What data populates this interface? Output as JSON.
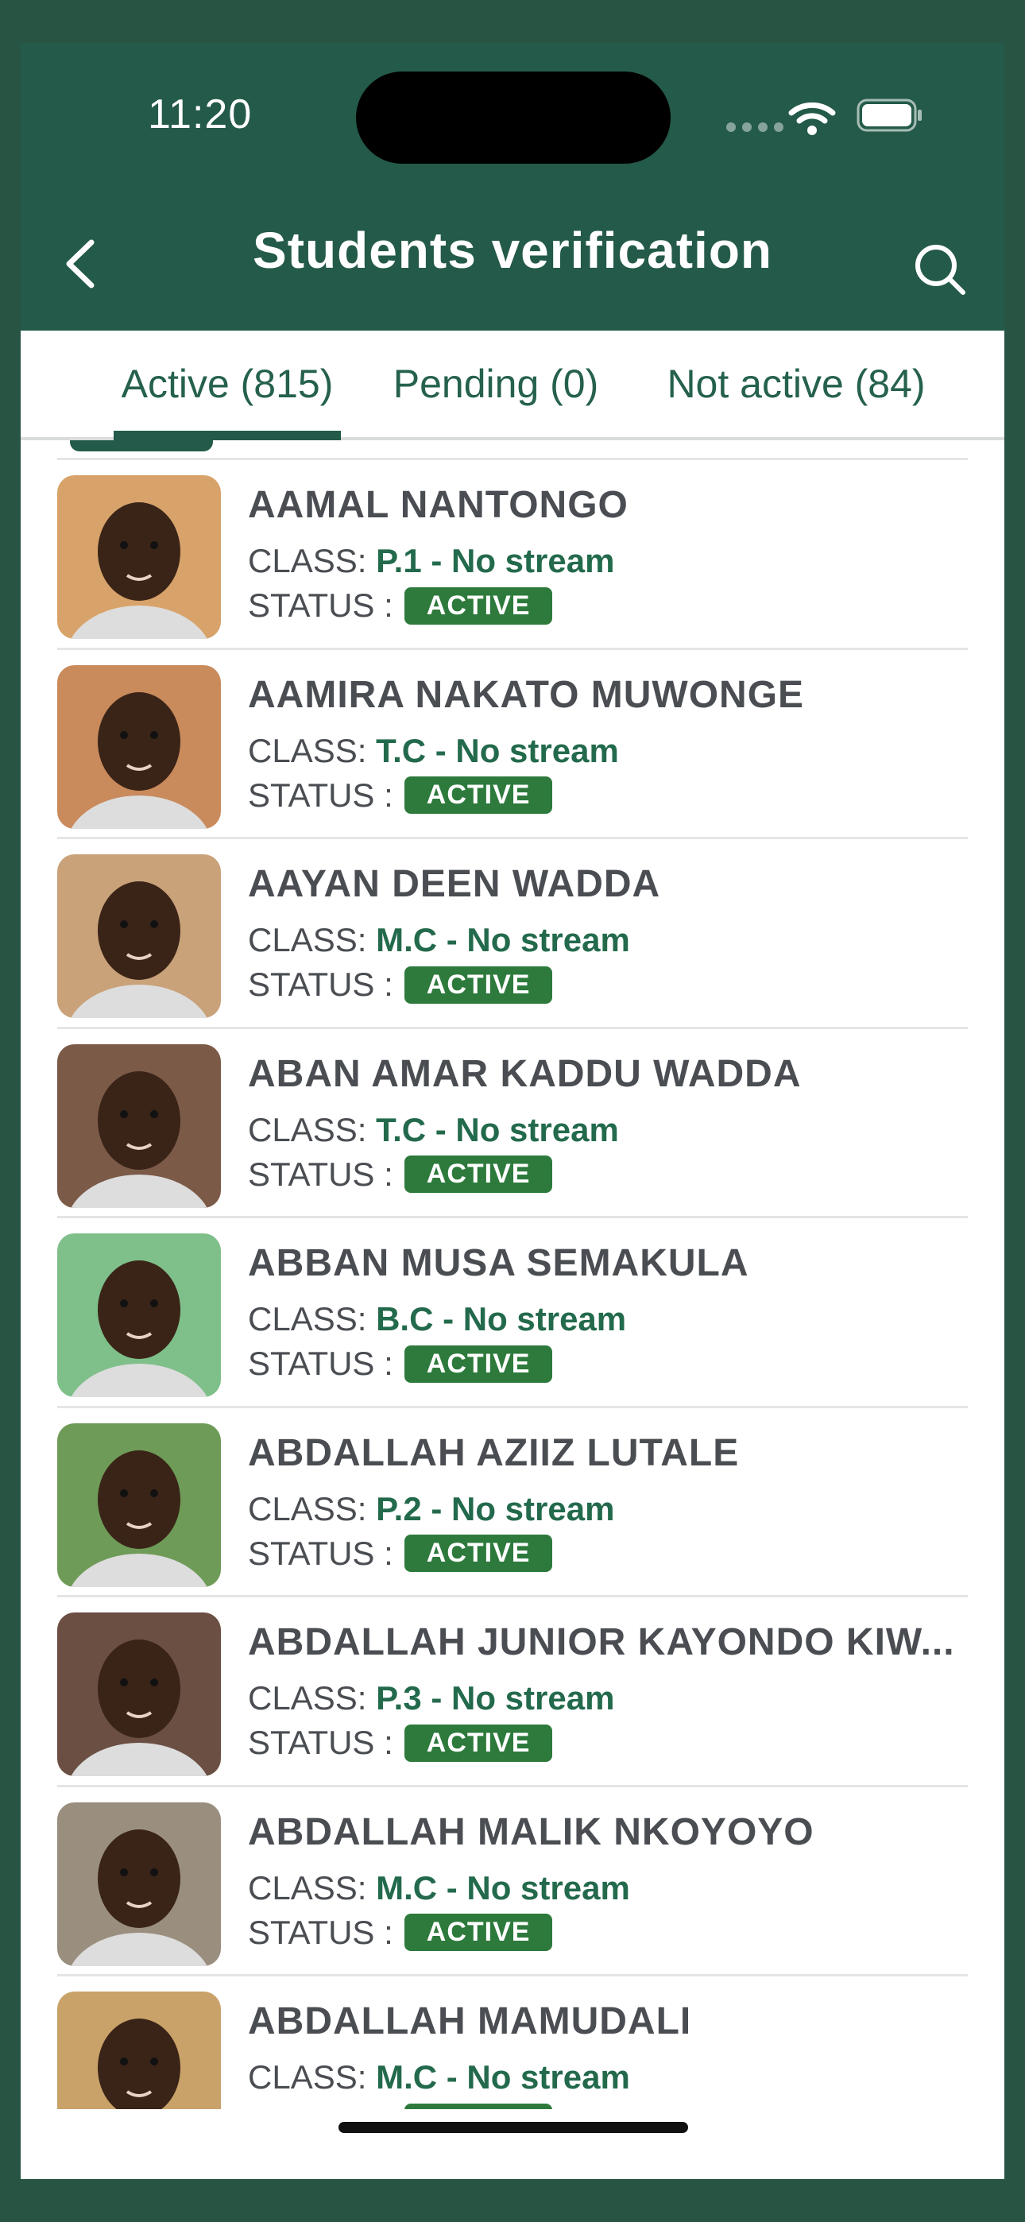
{
  "status_bar": {
    "time": "11:20"
  },
  "header": {
    "title": "Students verification"
  },
  "tabs": [
    {
      "label": "Active (815)",
      "active": true
    },
    {
      "label": "Pending (0)",
      "active": false
    },
    {
      "label": "Not active (84)",
      "active": false
    }
  ],
  "students": [
    {
      "name": "AAMAL NANTONGO",
      "class_label": "CLASS:",
      "class_value": "P.1 - No stream",
      "status_label": "STATUS :",
      "status": "ACTIVE",
      "photo_bg": "#d8a36a"
    },
    {
      "name": "AAMIRA NAKATO MUWONGE",
      "class_label": "CLASS:",
      "class_value": "T.C - No stream",
      "status_label": "STATUS :",
      "status": "ACTIVE",
      "photo_bg": "#c98a5c"
    },
    {
      "name": "AAYAN DEEN WADDA",
      "class_label": "CLASS:",
      "class_value": "M.C - No stream",
      "status_label": "STATUS :",
      "status": "ACTIVE",
      "photo_bg": "#c9a27a"
    },
    {
      "name": "ABAN AMAR KADDU WADDA",
      "class_label": "CLASS:",
      "class_value": "T.C - No stream",
      "status_label": "STATUS :",
      "status": "ACTIVE",
      "photo_bg": "#7c5a48"
    },
    {
      "name": "ABBAN MUSA SEMAKULA",
      "class_label": "CLASS:",
      "class_value": "B.C - No stream",
      "status_label": "STATUS :",
      "status": "ACTIVE",
      "photo_bg": "#7fbf8a"
    },
    {
      "name": "ABDALLAH AZIIZ LUTALE",
      "class_label": "CLASS:",
      "class_value": "P.2 - No stream",
      "status_label": "STATUS :",
      "status": "ACTIVE",
      "photo_bg": "#6e9b57"
    },
    {
      "name": "ABDALLAH JUNIOR KAYONDO KIW...",
      "class_label": "CLASS:",
      "class_value": "P.3 - No stream",
      "status_label": "STATUS :",
      "status": "ACTIVE",
      "photo_bg": "#6b4f43"
    },
    {
      "name": "ABDALLAH MALIK NKOYOYO",
      "class_label": "CLASS:",
      "class_value": "M.C - No stream",
      "status_label": "STATUS :",
      "status": "ACTIVE",
      "photo_bg": "#9a8f7e"
    },
    {
      "name": "ABDALLAH MAMUDALI",
      "class_label": "CLASS:",
      "class_value": "M.C - No stream",
      "status_label": "STATUS :",
      "status": "ACTIVE",
      "photo_bg": "#c9a26a"
    }
  ],
  "colors": {
    "header_bg": "#245a49",
    "accent_green": "#236a4c",
    "badge_green": "#2d7a3c"
  },
  "icons": {
    "back": "chevron-left-icon",
    "search": "search-icon",
    "wifi": "wifi-icon",
    "battery": "battery-icon"
  }
}
